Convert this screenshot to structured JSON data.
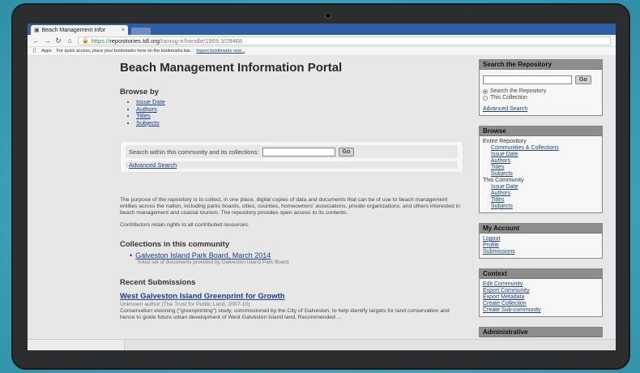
{
  "browser": {
    "tab_title": "Beach Management Infor",
    "tab_close": "×",
    "url_scheme": "https://",
    "url_host": "repositories.tdl.org",
    "url_path": "/tamug-ir/handle/1969.3/28468",
    "bookmarks_apps": "Apps",
    "bookmarks_hint": "For quick access, place your bookmarks here on the bookmarks bar.",
    "bookmarks_import": "Import bookmarks now..."
  },
  "main": {
    "title": "Beach Management Information Portal",
    "browse_by": "Browse by",
    "browse_links": [
      "Issue Date",
      "Authors",
      "Titles",
      "Subjects"
    ],
    "search_label": "Search within this community and its collections:",
    "go_label": "Go",
    "advanced_search": "Advanced Search",
    "description": "The purpose of the repository is to collect, in one place, digital copies of data and documents that can be of use to beach management entities across the nation, including parks boards, cities, counties, homeowners' associations, private organizations, and others interested in beach management and coastal tourism. The repository provides open access to its contents.",
    "rights": "Contributors retain rights to all contributed resources.",
    "collections_heading": "Collections in this community",
    "collection_title": "Galveston Island Park Board, March 2014",
    "collection_desc": "Initial set of documents provided by Galveston Island Park Board",
    "recent_heading": "Recent Submissions",
    "submission_title": "West Galveston Island Greenprint for Growth",
    "submission_author": "Unknown author (The Trust for Public Land, 2007-10)",
    "submission_abstract": "Conservation visioning (\"greenprinting\") study, commissioned by the City of Galveston, to help identify targets for land conservation and hence to guide future urban development of West Galveston Island land, Recommended ..."
  },
  "sidebar": {
    "search": {
      "heading": "Search the Repository",
      "go_label": "Go",
      "radio_repository": "Search the Repository",
      "radio_collection": "This Collection",
      "advanced": "Advanced Search"
    },
    "browse": {
      "heading": "Browse",
      "entire_repository": "Entire Repository",
      "entire_links": [
        "Communities & Collections",
        "Issue Date",
        "Authors",
        "Titles",
        "Subjects"
      ],
      "this_community": "This Community",
      "community_links": [
        "Issue Date",
        "Authors",
        "Titles",
        "Subjects"
      ]
    },
    "account": {
      "heading": "My Account",
      "links": [
        "Logout",
        "Profile",
        "Submissions"
      ]
    },
    "context": {
      "heading": "Context",
      "links": [
        "Edit Community",
        "Export Community",
        "Export Metadata",
        "Create Collection",
        "Create Sub-community"
      ]
    },
    "administrative": {
      "heading": "Administrative"
    }
  }
}
